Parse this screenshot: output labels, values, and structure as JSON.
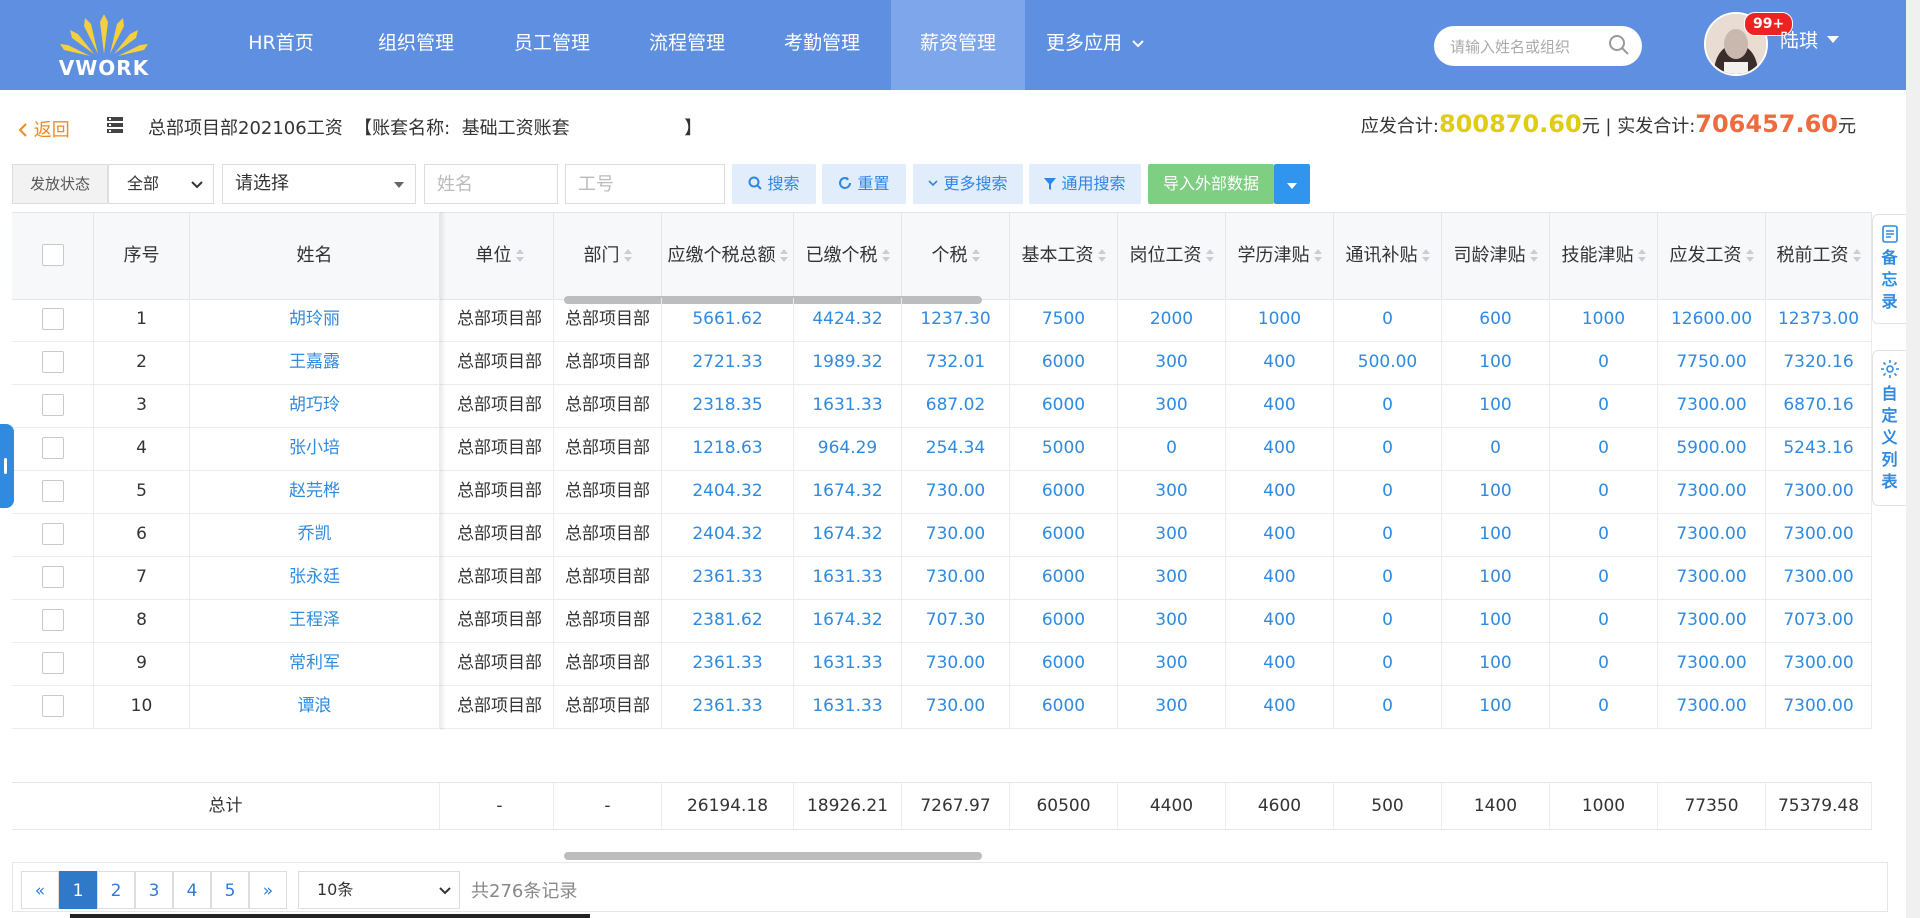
{
  "app": {
    "logo_text": "VWORK"
  },
  "nav": {
    "items": [
      {
        "label": "HR首页"
      },
      {
        "label": "组织管理"
      },
      {
        "label": "员工管理"
      },
      {
        "label": "流程管理"
      },
      {
        "label": "考勤管理"
      },
      {
        "label": "薪资管理",
        "active": true
      },
      {
        "label": "更多应用"
      }
    ],
    "search_placeholder": "请输入姓名或组织",
    "badge": "99+",
    "user_name": "陆琪"
  },
  "header": {
    "back_label": "返回",
    "title": "总部项目部202106工资  【账套名称:  基础工资账套                    】",
    "due_total_label": "应发合计:",
    "due_total_value": "800870.60",
    "currency": "元",
    "separator": " | ",
    "paid_total_label": "实发合计:",
    "paid_total_value": "706457.60",
    "currency2": "元"
  },
  "filters": {
    "status_label": "发放状态",
    "status_value": "全部",
    "select_placeholder": "请选择",
    "name_placeholder": "姓名",
    "id_placeholder": "工号",
    "search_btn": "搜索",
    "reset_btn": "重置",
    "more_search_btn": "更多搜索",
    "general_search_btn": "通用搜索",
    "import_btn": "导入外部数据"
  },
  "table": {
    "columns": [
      "序号",
      "姓名",
      "单位",
      "部门",
      "应缴个税总额",
      "已缴个税",
      "个税",
      "基本工资",
      "岗位工资",
      "学历津贴",
      "通讯补贴",
      "司龄津贴",
      "技能津贴",
      "应发工资",
      "税前工资"
    ],
    "rows": [
      [
        "1",
        "胡玲丽",
        "总部项目部",
        "总部项目部",
        "5661.62",
        "4424.32",
        "1237.30",
        "7500",
        "2000",
        "1000",
        "0",
        "600",
        "1000",
        "12600.00",
        "12373.00"
      ],
      [
        "2",
        "王嘉露",
        "总部项目部",
        "总部项目部",
        "2721.33",
        "1989.32",
        "732.01",
        "6000",
        "300",
        "400",
        "500.00",
        "100",
        "0",
        "7750.00",
        "7320.16"
      ],
      [
        "3",
        "胡巧玲",
        "总部项目部",
        "总部项目部",
        "2318.35",
        "1631.33",
        "687.02",
        "6000",
        "300",
        "400",
        "0",
        "100",
        "0",
        "7300.00",
        "6870.16"
      ],
      [
        "4",
        "张小培",
        "总部项目部",
        "总部项目部",
        "1218.63",
        "964.29",
        "254.34",
        "5000",
        "0",
        "400",
        "0",
        "0",
        "0",
        "5900.00",
        "5243.16"
      ],
      [
        "5",
        "赵芫桦",
        "总部项目部",
        "总部项目部",
        "2404.32",
        "1674.32",
        "730.00",
        "6000",
        "300",
        "400",
        "0",
        "100",
        "0",
        "7300.00",
        "7300.00"
      ],
      [
        "6",
        "乔凯",
        "总部项目部",
        "总部项目部",
        "2404.32",
        "1674.32",
        "730.00",
        "6000",
        "300",
        "400",
        "0",
        "100",
        "0",
        "7300.00",
        "7300.00"
      ],
      [
        "7",
        "张永廷",
        "总部项目部",
        "总部项目部",
        "2361.33",
        "1631.33",
        "730.00",
        "6000",
        "300",
        "400",
        "0",
        "100",
        "0",
        "7300.00",
        "7300.00"
      ],
      [
        "8",
        "王程泽",
        "总部项目部",
        "总部项目部",
        "2381.62",
        "1674.32",
        "707.30",
        "6000",
        "300",
        "400",
        "0",
        "100",
        "0",
        "7300.00",
        "7073.00"
      ],
      [
        "9",
        "常利军",
        "总部项目部",
        "总部项目部",
        "2361.33",
        "1631.33",
        "730.00",
        "6000",
        "300",
        "400",
        "0",
        "100",
        "0",
        "7300.00",
        "7300.00"
      ],
      [
        "10",
        "谭浪",
        "总部项目部",
        "总部项目部",
        "2361.33",
        "1631.33",
        "730.00",
        "6000",
        "300",
        "400",
        "0",
        "100",
        "0",
        "7300.00",
        "7300.00"
      ]
    ],
    "total_label": "总计",
    "totals": [
      "-",
      "-",
      "26194.18",
      "18926.21",
      "7267.97",
      "60500",
      "4400",
      "4600",
      "500",
      "1400",
      "1000",
      "77350",
      "75379.48"
    ]
  },
  "pager": {
    "prev": "«",
    "pages": [
      "1",
      "2",
      "3",
      "4",
      "5"
    ],
    "next": "»",
    "page_size": "10条",
    "total_text": "共276条记录"
  },
  "side": {
    "memo": "备忘录",
    "custom": "自定义列表"
  },
  "colors": {
    "nav_bg": "#5f8fe0",
    "link_blue": "#2f8ae0",
    "due_total": "#e0cc14",
    "paid_total": "#ef6b3e",
    "back": "#f08a1c"
  }
}
